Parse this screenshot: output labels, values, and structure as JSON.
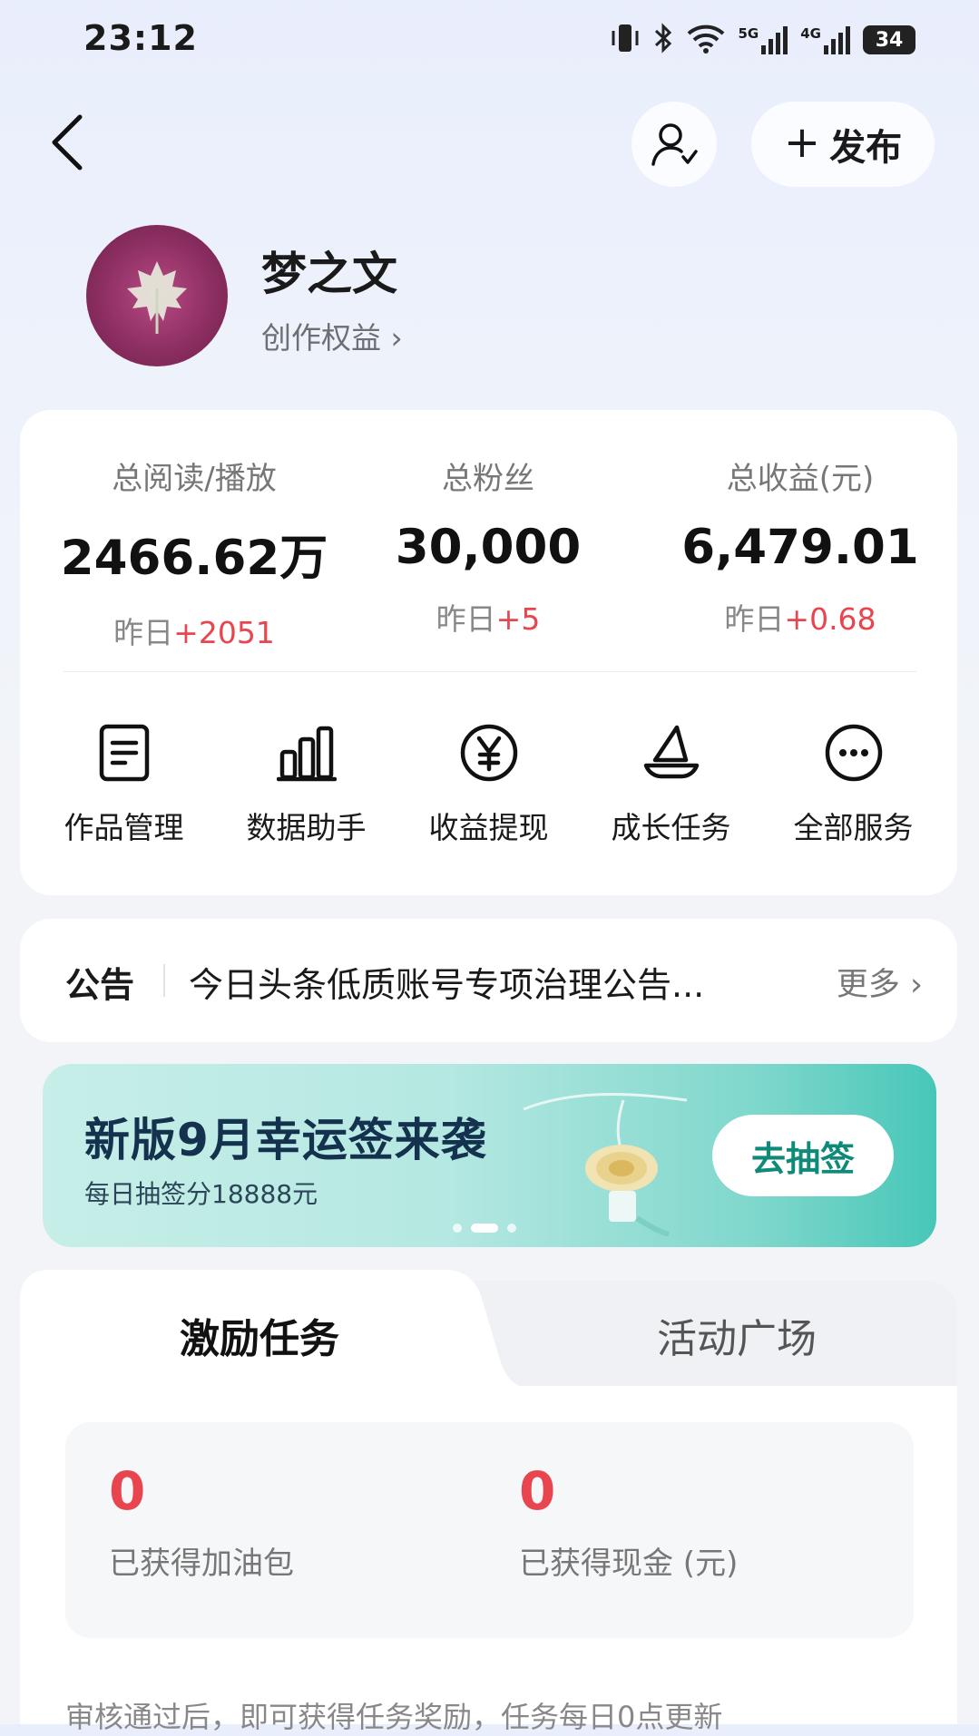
{
  "status_bar": {
    "time": "23:12",
    "battery": "34",
    "net_5g": "5G",
    "net_4g": "4G"
  },
  "header": {
    "publish_label": "发布"
  },
  "profile": {
    "name": "梦之文",
    "rights_link": "创作权益 ›"
  },
  "stats": [
    {
      "label": "总阅读/播放",
      "value": "2466.62万",
      "change_prefix": "昨日",
      "change_delta": "+2051"
    },
    {
      "label": "总粉丝",
      "value": "30,000",
      "change_prefix": "昨日",
      "change_delta": "+5"
    },
    {
      "label": "总收益(元)",
      "value": "6,479.01",
      "change_prefix": "昨日",
      "change_delta": "+0.68"
    }
  ],
  "services": [
    {
      "label": "作品管理",
      "icon": "document-icon"
    },
    {
      "label": "数据助手",
      "icon": "bar-chart-icon"
    },
    {
      "label": "收益提现",
      "icon": "yuan-icon"
    },
    {
      "label": "成长任务",
      "icon": "sailboat-icon"
    },
    {
      "label": "全部服务",
      "icon": "more-icon"
    }
  ],
  "notice": {
    "title": "公告",
    "text": "今日头条低质账号专项治理公告...",
    "more": "更多 ›"
  },
  "banner": {
    "title": "新版9月幸运签来袭",
    "subtitle": "每日抽签分18888元",
    "button": "去抽签"
  },
  "tasks": {
    "tabs": [
      "激励任务",
      "活动广场"
    ],
    "rewards": [
      {
        "value": "0",
        "label": "已获得加油包"
      },
      {
        "value": "0",
        "label": "已获得现金 (元)"
      }
    ],
    "footer": "审核通过后，即可获得任务奖励，任务每日0点更新"
  },
  "colors": {
    "accent_red": "#e8454f",
    "teal": "#0f8a78",
    "banner_title": "#14324d"
  }
}
